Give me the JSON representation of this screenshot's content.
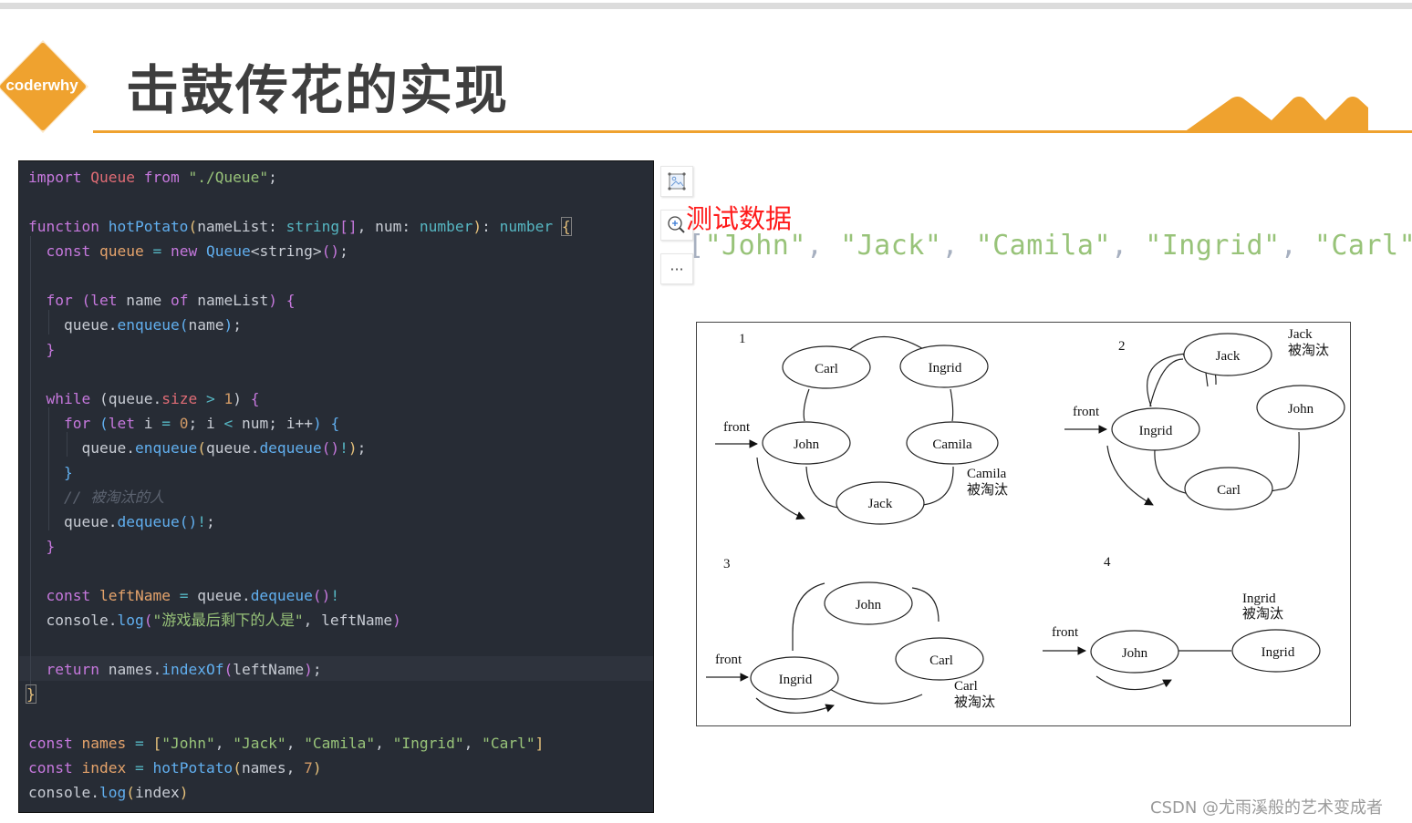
{
  "header": {
    "logo_text": "coderwhy",
    "title": "击鼓传花的实现",
    "accent_color": "#efa22f"
  },
  "code": {
    "language": "typescript",
    "theme_background": "#272c35",
    "lines": [
      "import Queue from \"./Queue\";",
      "",
      "function hotPotato(nameList: string[], num: number): number {",
      "  const queue = new Queue<string>();",
      "",
      "  for (let name of nameList) {",
      "    queue.enqueue(name);",
      "  }",
      "",
      "  while (queue.size > 1) {",
      "    for (let i = 0; i < num; i++) {",
      "      queue.enqueue(queue.dequeue()!);",
      "    }",
      "    // 被淘汰的人",
      "    queue.dequeue()!;",
      "  }",
      "",
      "  const leftName = queue.dequeue()!",
      "  console.log(\"游戏最后剩下的人是\", leftName)",
      "",
      "  return names.indexOf(leftName);",
      "}",
      "",
      "const names = [\"John\", \"Jack\", \"Camila\", \"Ingrid\", \"Carl\"]",
      "const index = hotPotato(names, 7)",
      "console.log(index)"
    ],
    "tokens": {
      "import": "import",
      "Queue": "Queue",
      "from": "from",
      "path": "\"./Queue\"",
      "semi": ";",
      "function": "function",
      "hotPotato": "hotPotato",
      "nameList": "nameList",
      "string_t": "string",
      "num": "num",
      "number_t": "number",
      "const": "const",
      "queue": "queue",
      "new": "new",
      "string_lt": "<string>",
      "for": "for",
      "let": "let",
      "name": "name",
      "of": "of",
      "enqueue": "enqueue",
      "dequeue": "dequeue",
      "while": "while",
      "size": "size",
      "one": "1",
      "i": "i",
      "zero": "0",
      "inc": "i++",
      "comment": "// 被淘汰的人",
      "leftName": "leftName",
      "console": "console",
      "log": "log",
      "msg": "\"游戏最后剩下的人是\"",
      "return": "return",
      "names": "names",
      "indexOf": "indexOf",
      "index": "index",
      "seven": "7",
      "john": "\"John\"",
      "jack": "\"Jack\"",
      "camila": "\"Camila\"",
      "ingrid": "\"Ingrid\"",
      "carl": "\"Carl\""
    }
  },
  "toolbar": {
    "buttons": [
      {
        "name": "image-icon",
        "glyph": "🖼"
      },
      {
        "name": "zoom-in-icon",
        "glyph": "⊕"
      },
      {
        "name": "more-icon",
        "glyph": "···"
      }
    ]
  },
  "test_data": {
    "label": "测试数据",
    "open_bracket": "[",
    "close_bracket": "]",
    "separator": ", ",
    "values": [
      "\"John\"",
      "\"Jack\"",
      "\"Camila\"",
      "\"Ingrid\"",
      "\"Carl\""
    ]
  },
  "diagram": {
    "front_label": "front",
    "eliminated_suffix": "被淘汰",
    "panels": [
      {
        "step": "1",
        "nodes": [
          "Carl",
          "Ingrid",
          "John",
          "Camila",
          "Jack"
        ],
        "front": "John",
        "eliminated": "Camila"
      },
      {
        "step": "2",
        "nodes": [
          "Jack",
          "John",
          "Ingrid",
          "Carl"
        ],
        "front": "Ingrid",
        "eliminated": "Jack"
      },
      {
        "step": "3",
        "nodes": [
          "John",
          "Carl",
          "Ingrid"
        ],
        "front": "Ingrid",
        "eliminated": "Carl"
      },
      {
        "step": "4",
        "nodes": [
          "John",
          "Ingrid"
        ],
        "front": "John",
        "eliminated": "Ingrid"
      }
    ]
  },
  "watermark": "CSDN @尤雨溪般的艺术变成者"
}
